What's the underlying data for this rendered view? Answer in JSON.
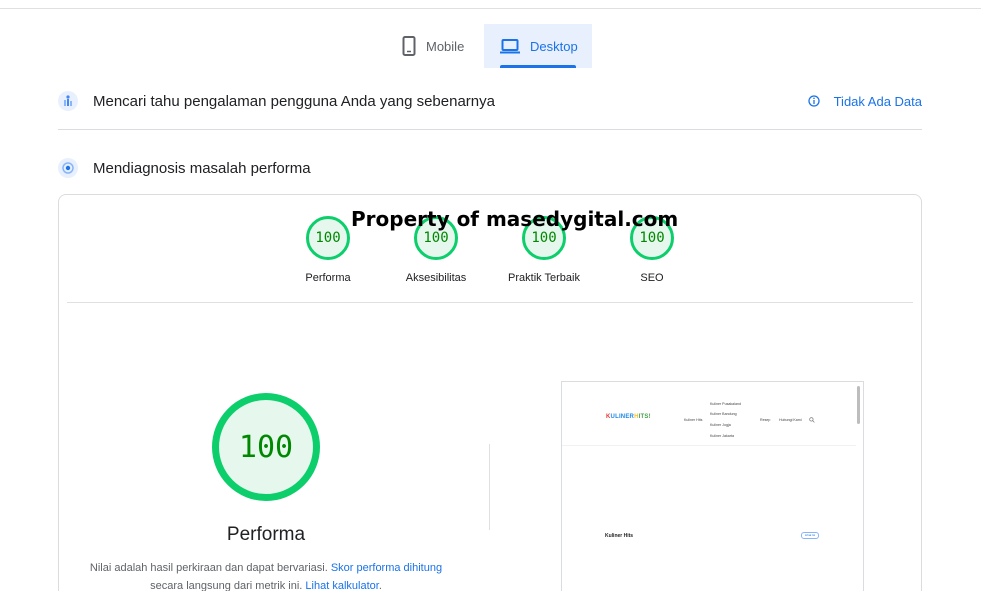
{
  "tabs": {
    "mobile_label": "Mobile",
    "desktop_label": "Desktop",
    "active": "Desktop"
  },
  "field_data": {
    "title": "Mencari tahu pengalaman pengguna Anda yang sebenarnya",
    "status_label": "Tidak Ada Data"
  },
  "diagnose": {
    "title": "Mendiagnosis masalah performa"
  },
  "watermark": "Property of masedygital.com",
  "scores": [
    {
      "value": "100",
      "label": "Performa"
    },
    {
      "value": "100",
      "label": "Aksesibilitas"
    },
    {
      "value": "100",
      "label": "Praktik Terbaik"
    },
    {
      "value": "100",
      "label": "SEO"
    }
  ],
  "performance": {
    "value": "100",
    "title": "Performa",
    "note_text1": "Nilai adalah hasil perkiraan dan dapat bervariasi. ",
    "note_link1": "Skor performa dihitung",
    "note_text2": "secara langsung dari metrik ini. ",
    "note_link2": "Lihat kalkulator",
    "note_end": "."
  },
  "preview": {
    "logo_parts": [
      "K",
      "ULINER",
      "H",
      "ITS!"
    ],
    "nav": [
      "Kuliner Hits",
      "Kuliner Pusakaland",
      "Kuliner Bandung",
      "Kuliner Jogja",
      "Kuliner Jakarta",
      "Resep",
      "Hubungi Kami"
    ],
    "heading": "Kuliner Hits",
    "button": "Lihat Isi"
  },
  "colors": {
    "score_good": "#0cce6b",
    "link": "#1a73e8",
    "active_tab_bg": "#e8f0fe"
  }
}
